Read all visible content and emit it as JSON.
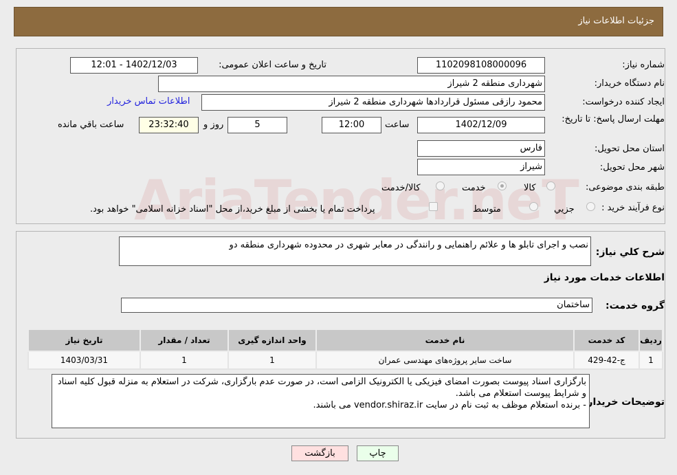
{
  "header": {
    "title": "جزئیات اطلاعات نیاز"
  },
  "form": {
    "need_number_label": "شماره نیاز:",
    "need_number": "1102098108000096",
    "announce_label": "تاریخ و ساعت اعلان عمومی:",
    "announce_value": "1402/12/03 - 12:01",
    "buyer_org_label": "نام دستگاه خریدار:",
    "buyer_org": "شهرداری منطقه 2 شیراز",
    "creator_label": "ایجاد کننده درخواست:",
    "creator": "محمود رازقی مسئول قراردادها شهرداری منطقه 2 شیراز",
    "contact_link": "اطلاعات تماس خریدار",
    "deadline_label": "مهلت ارسال پاسخ: تا تاریخ:",
    "deadline_date": "1402/12/09",
    "time_label": "ساعت",
    "deadline_time": "12:00",
    "days": "5",
    "days_label": "روز و",
    "remaining": "23:32:40",
    "remaining_label": "ساعت باقي مانده",
    "province_label": "استان محل تحویل:",
    "province": "فارس",
    "city_label": "شهر محل تحویل:",
    "city": "شیراز",
    "category_label": "طبقه بندی موضوعی:",
    "category_options": [
      "کالا",
      "خدمت",
      "کالا/خدمت"
    ],
    "category_selected": "خدمت",
    "process_label": "نوع فرآیند خرید :",
    "process_options": [
      "جزیي",
      "متوسط"
    ],
    "process_note": "پرداخت تمام یا بخشی از مبلغ خرید،از محل \"اسناد خزانه اسلامی\" خواهد بود."
  },
  "watermark": "AriaTender.neT",
  "details": {
    "summary_label": "شرح كلي نياز:",
    "summary": "نصب و اجرای تابلو ها و علائم راهنمایی و رانندگی در معابر شهری در محدوده شهرداری منطقه دو",
    "services_title": "اطلاعات خدمات مورد نیاز",
    "group_label": "گروه خدمت:",
    "group": "ساختمان",
    "table": {
      "headers": [
        "ردیف",
        "کد خدمت",
        "نام خدمت",
        "واحد اندازه گیری",
        "تعداد / مقدار",
        "تاریخ نیاز"
      ],
      "rows": [
        [
          "1",
          "ج-42-429",
          "ساخت سایر پروژه‌های مهندسی عمران",
          "1",
          "1",
          "1403/03/31"
        ]
      ]
    },
    "buyer_notes_label": "توضیحات خریدار:",
    "buyer_notes": [
      "بارگزاری اسناد پیوست بصورت امضای فیزیکی یا الکترونیک الزامی است، در صورت عدم بارگزاری، شرکت در استعلام به منزله قبول کلیه اسناد و شرایط پیوست استعلام می باشد.",
      "- برنده استعلام موظف به ثبت نام در سایت vendor.shiraz.ir می باشند."
    ]
  },
  "buttons": {
    "print": "چاپ",
    "back": "بازگشت"
  }
}
